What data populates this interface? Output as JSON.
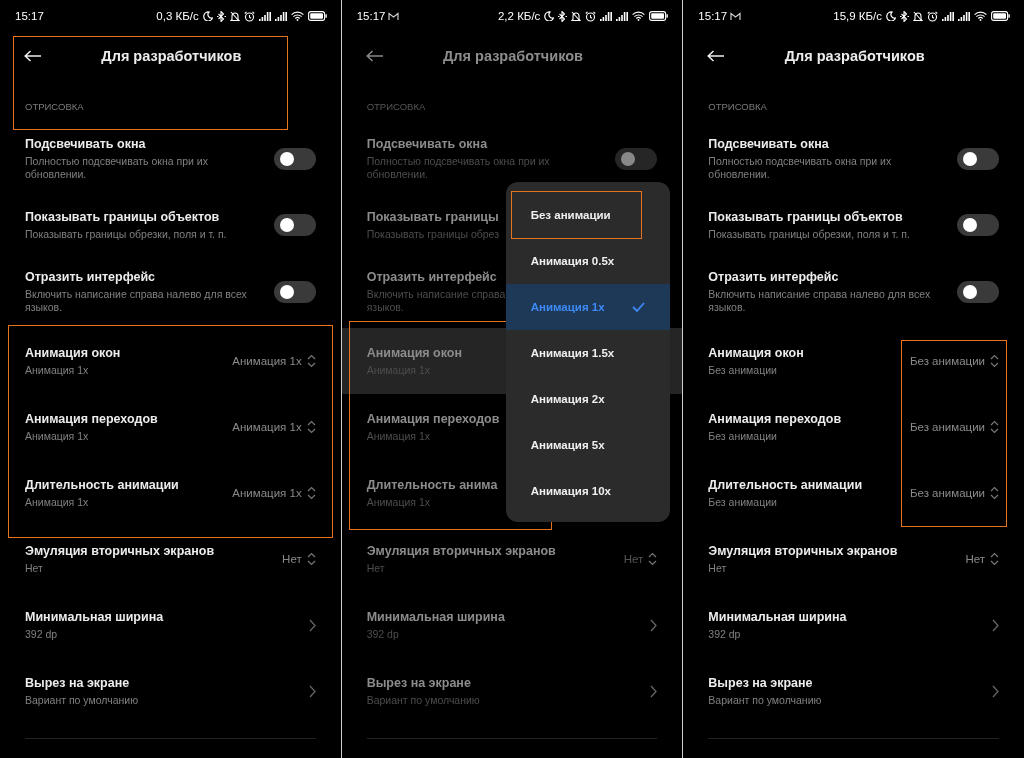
{
  "panels": [
    {
      "status_bar": {
        "time": "15:17",
        "speed": "0,3 КБ/с"
      },
      "dimmed": false,
      "title": "Для разработчиков",
      "header_framed": true,
      "section": "ОТРИСОВКА",
      "toggles": [
        {
          "title": "Подсвечивать окна",
          "subtitle": "Полностью подсвечивать окна при их обновлении.",
          "on": false
        },
        {
          "title": "Показывать границы объектов",
          "subtitle": "Показывать границы обрезки, поля и т. п.",
          "on": false
        },
        {
          "title": "Отразить интерфейс",
          "subtitle": "Включить написание справа налево для всех языков.",
          "on": false
        }
      ],
      "animation_settings": {
        "titles_framed": true,
        "values_framed": true,
        "rows": [
          {
            "title": "Анимация окон",
            "subtitle": "Анимация 1x",
            "value": "Анимация 1x",
            "pressed": false
          },
          {
            "title": "Анимация переходов",
            "subtitle": "Анимация 1x",
            "value": "Анимация 1x",
            "pressed": false
          },
          {
            "title": "Длительность анимации",
            "subtitle": "Анимация 1x",
            "value": "Анимация 1x",
            "pressed": false
          }
        ]
      },
      "more_rows": [
        {
          "kind": "picker",
          "title": "Эмуляция вторичных экранов",
          "subtitle": "Нет",
          "value": "Нет"
        },
        {
          "kind": "link",
          "title": "Минимальная ширина",
          "subtitle": "392 dp"
        },
        {
          "kind": "link",
          "title": "Вырез на экране",
          "subtitle": "Вариант по умолчанию"
        }
      ]
    },
    {
      "status_bar": {
        "time": "15:17",
        "mail_icon": true,
        "speed": "2,2 КБ/с"
      },
      "dimmed": true,
      "title": "Для разработчиков",
      "header_framed": false,
      "section": "ОТРИСОВКА",
      "toggles": [
        {
          "title": "Подсвечивать окна",
          "subtitle": "Полностью подсвечивать окна при их обновлении.",
          "on": false
        },
        {
          "title": "Показывать границы",
          "subtitle": "Показывать границы обрез"
        },
        {
          "title": "Отразить интерфейс",
          "subtitle": "Включить написание справа\nязыков."
        }
      ],
      "animation_settings": {
        "titles_framed": true,
        "values_framed": false,
        "rows": [
          {
            "title": "Анимация окон",
            "subtitle": "Анимация 1x",
            "pressed": true
          },
          {
            "title": "Анимация переходов",
            "subtitle": "Анимация 1x",
            "pressed": false
          },
          {
            "title": "Длительность анима",
            "subtitle": "Анимация 1x",
            "pressed": false
          }
        ]
      },
      "more_rows": [
        {
          "kind": "picker",
          "title": "Эмуляция вторичных экранов",
          "subtitle": "Нет",
          "value": "Нет"
        },
        {
          "kind": "link",
          "title": "Минимальная ширина",
          "subtitle": "392 dp"
        },
        {
          "kind": "link",
          "title": "Вырез на экране",
          "subtitle": "Вариант по умолчанию"
        }
      ],
      "dropdown": {
        "options": [
          {
            "label": "Без анимации",
            "selected": false,
            "framed": true
          },
          {
            "label": "Анимация 0.5x",
            "selected": false,
            "framed": false
          },
          {
            "label": "Анимация 1x",
            "selected": true,
            "framed": false
          },
          {
            "label": "Анимация 1.5x",
            "selected": false,
            "framed": false
          },
          {
            "label": "Анимация 2x",
            "selected": false,
            "framed": false
          },
          {
            "label": "Анимация 5x",
            "selected": false,
            "framed": false
          },
          {
            "label": "Анимация 10x",
            "selected": false,
            "framed": false
          }
        ]
      }
    },
    {
      "status_bar": {
        "time": "15:17",
        "mail_icon": true,
        "speed": "15,9 КБ/с"
      },
      "dimmed": false,
      "title": "Для разработчиков",
      "header_framed": false,
      "section": "ОТРИСОВКА",
      "toggles": [
        {
          "title": "Подсвечивать окна",
          "subtitle": "Полностью подсвечивать окна при их обновлении.",
          "on": false
        },
        {
          "title": "Показывать границы объектов",
          "subtitle": "Показывать границы обрезки, поля и т. п.",
          "on": false
        },
        {
          "title": "Отразить интерфейс",
          "subtitle": "Включить написание справа налево для всех языков.",
          "on": false
        }
      ],
      "animation_settings": {
        "titles_framed": false,
        "values_framed": true,
        "rows": [
          {
            "title": "Анимация окон",
            "subtitle": "Без анимации",
            "value": "Без анимации",
            "pressed": false
          },
          {
            "title": "Анимация переходов",
            "subtitle": "Без анимации",
            "value": "Без анимации",
            "pressed": false
          },
          {
            "title": "Длительность анимации",
            "subtitle": "Без анимации",
            "value": "Без анимации",
            "pressed": false
          }
        ]
      },
      "more_rows": [
        {
          "kind": "picker",
          "title": "Эмуляция вторичных экранов",
          "subtitle": "Нет",
          "value": "Нет"
        },
        {
          "kind": "link",
          "title": "Минимальная ширина",
          "subtitle": "392 dp"
        },
        {
          "kind": "link",
          "title": "Вырез на экране",
          "subtitle": "Вариант по умолчанию"
        }
      ]
    }
  ]
}
